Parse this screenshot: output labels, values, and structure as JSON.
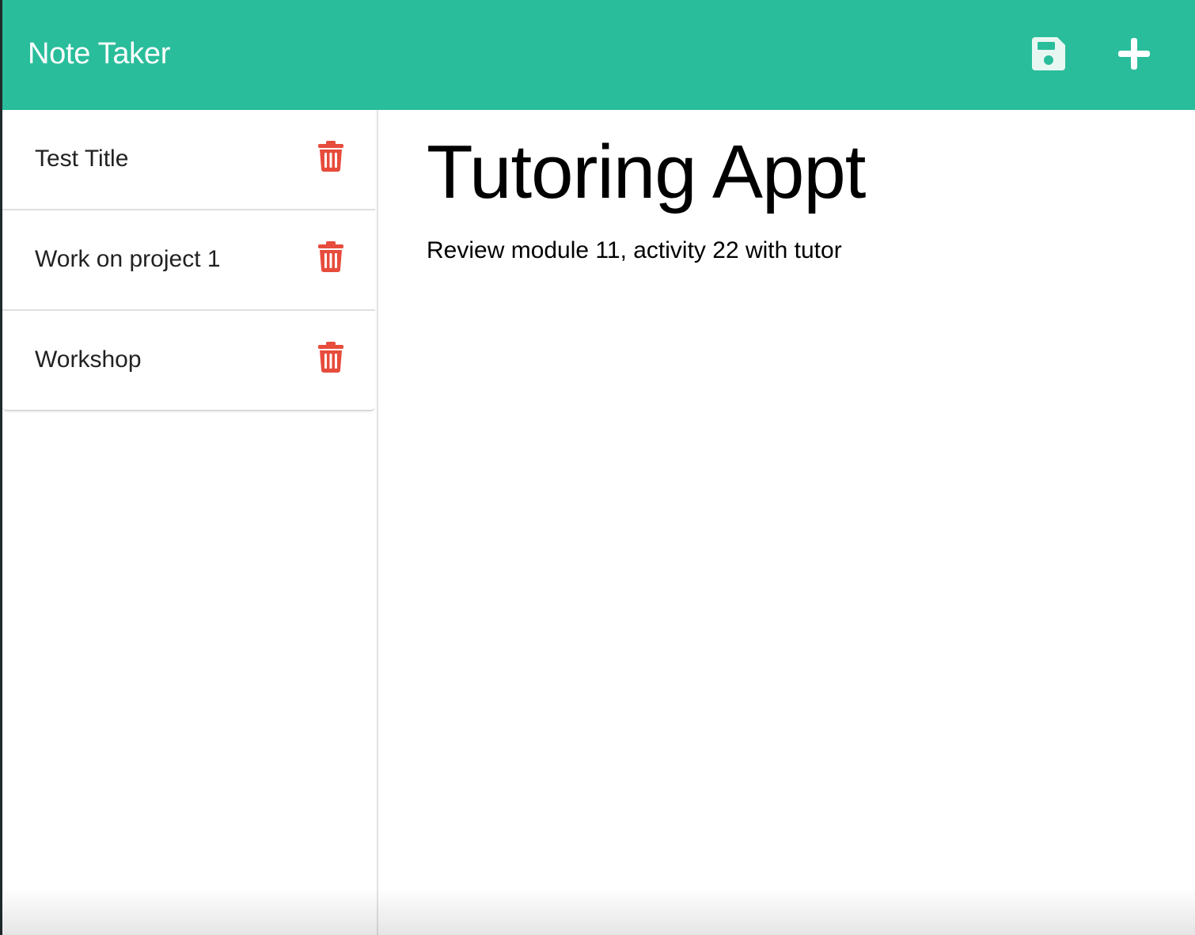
{
  "app": {
    "title": "Note Taker"
  },
  "toolbar": {
    "save_icon": "floppy-disk-save-icon",
    "new_icon": "plus-icon"
  },
  "notes": [
    {
      "title": "Test Title",
      "delete_icon": "trash-icon"
    },
    {
      "title": "Work on project 1",
      "delete_icon": "trash-icon"
    },
    {
      "title": "Workshop",
      "delete_icon": "trash-icon"
    }
  ],
  "active_note": {
    "title": "Tutoring Appt",
    "text": "Review module 11, activity 22 with tutor"
  },
  "colors": {
    "navbar": "#2abd9b",
    "delete_icon": "#e74c3c",
    "toolbar_icon": "#ffffff"
  }
}
